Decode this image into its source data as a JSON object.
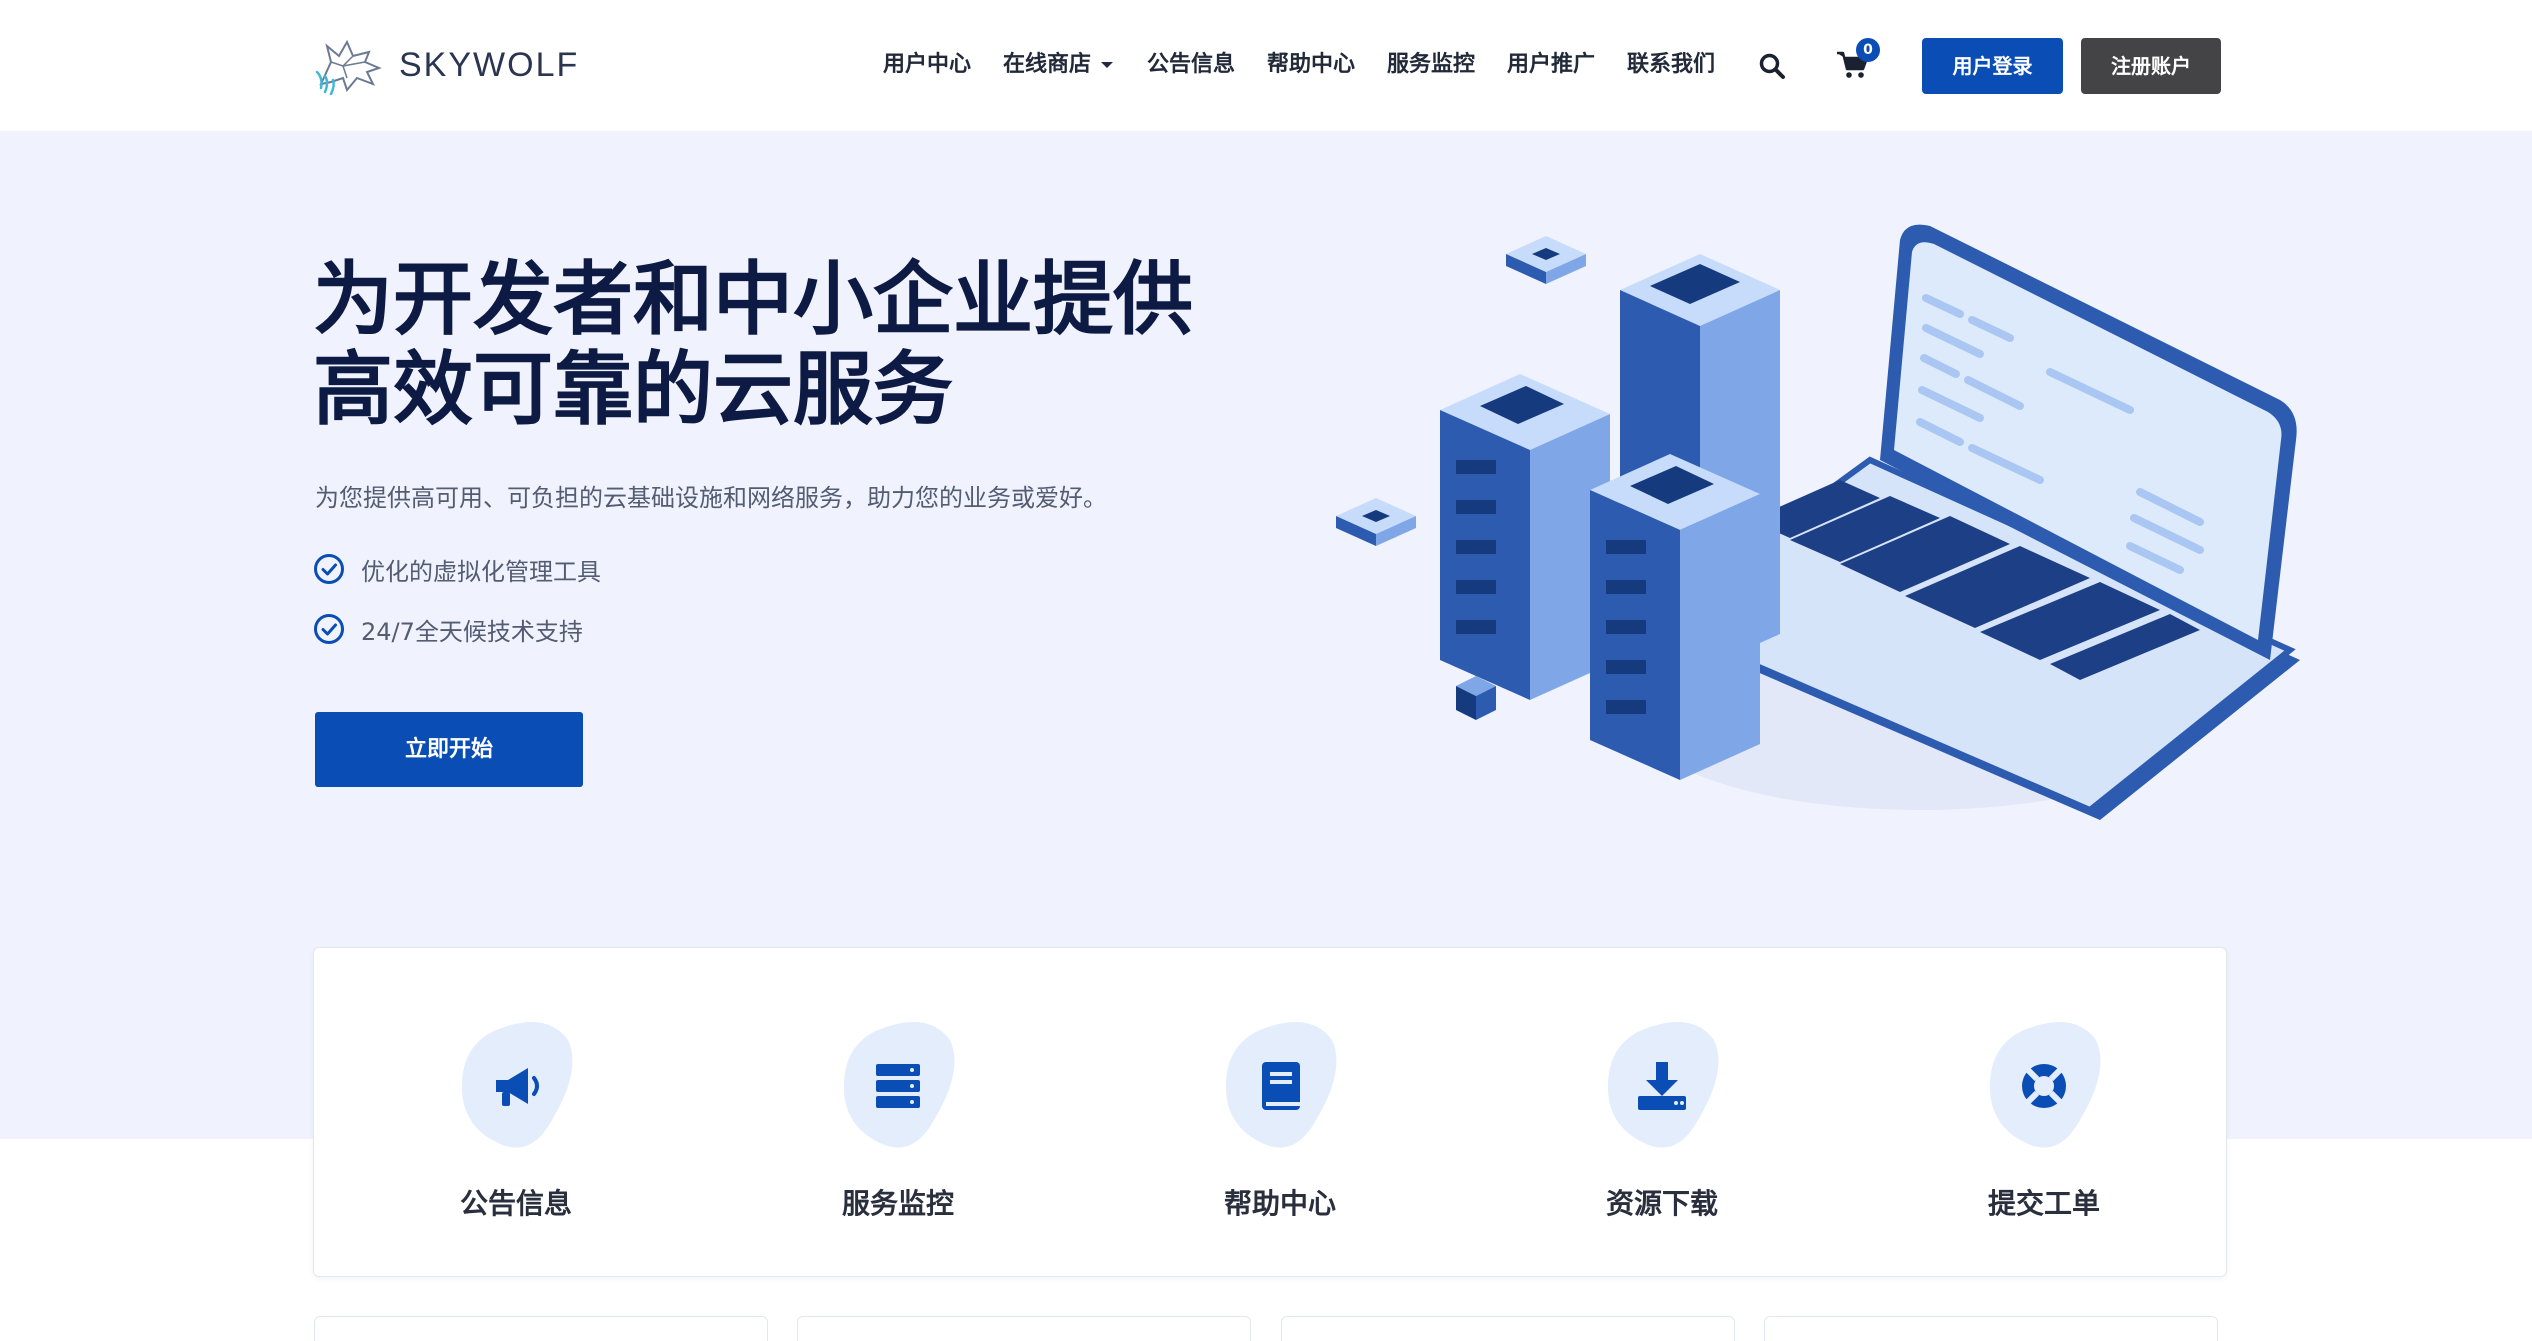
{
  "brand": {
    "name": "SKYWOLF",
    "logo_icon": "wolf-logo-icon"
  },
  "nav": {
    "items": [
      {
        "label": "用户中心"
      },
      {
        "label": "在线商店",
        "has_dropdown": true
      },
      {
        "label": "公告信息"
      },
      {
        "label": "帮助中心"
      },
      {
        "label": "服务监控"
      },
      {
        "label": "用户推广"
      },
      {
        "label": "联系我们"
      }
    ],
    "search_icon": "search-icon",
    "cart_icon": "cart-icon",
    "cart_count": "0",
    "login_label": "用户登录",
    "register_label": "注册账户"
  },
  "hero": {
    "title_line1": "为开发者和中小企业提供",
    "title_line2": "高效可靠的云服务",
    "subtitle": "为您提供高可用、可负担的云基础设施和网络服务，助力您的业务或爱好。",
    "features": [
      {
        "label": "优化的虚拟化管理工具",
        "icon": "check-circle-icon"
      },
      {
        "label": "24/7全天候技术支持",
        "icon": "check-circle-icon"
      }
    ],
    "cta_label": "立即开始"
  },
  "quick_links": [
    {
      "label": "公告信息",
      "icon": "megaphone-icon"
    },
    {
      "label": "服务监控",
      "icon": "server-icon"
    },
    {
      "label": "帮助中心",
      "icon": "book-icon"
    },
    {
      "label": "资源下载",
      "icon": "download-icon"
    },
    {
      "label": "提交工单",
      "icon": "lifebuoy-icon"
    }
  ],
  "colors": {
    "primary": "#0a4db5",
    "dark_button": "#444446",
    "hero_bg": "#f0f3fd",
    "title": "#0d1b44",
    "blob": "#e3edfc"
  }
}
